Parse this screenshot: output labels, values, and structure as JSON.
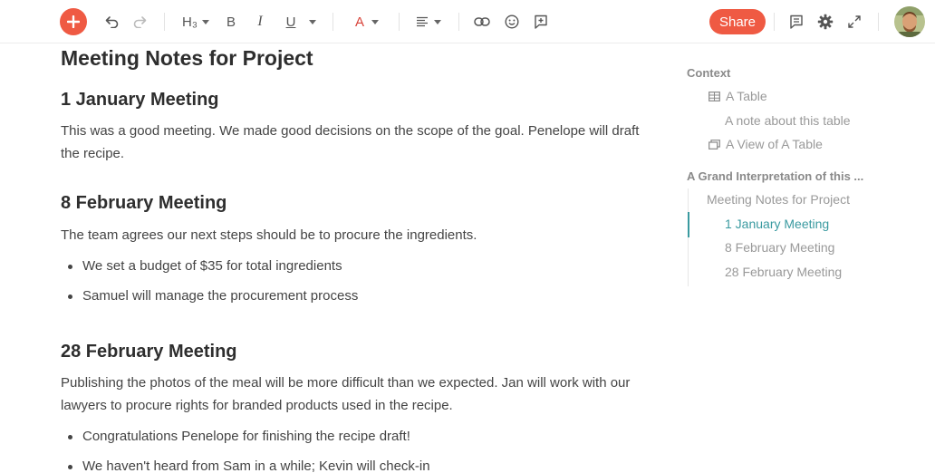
{
  "toolbar": {
    "heading_label": "H₃",
    "bold_label": "B",
    "italic_label": "I",
    "underline_label": "U",
    "color_label": "A",
    "share_label": "Share",
    "accent_color": "#ef5a43"
  },
  "document": {
    "title": "Meeting Notes for Project",
    "sections": [
      {
        "heading": "1 January Meeting",
        "paragraph": "This was a good meeting. We made good decisions on the scope of the goal. Penelope will draft the recipe."
      },
      {
        "heading": "8 February Meeting",
        "paragraph": "The team agrees our next steps should be to procure the ingredients.",
        "bullets": [
          "We set a budget of $35 for total ingredients",
          "Samuel will manage the procurement process"
        ]
      },
      {
        "heading": "28 February Meeting",
        "paragraph": "Publishing the photos of the meal will be more difficult than we expected. Jan will work with our lawyers to procure rights for branded products used in the recipe.",
        "bullets": [
          "Congratulations Penelope for finishing the recipe draft!",
          "We haven't heard from Sam in a while; Kevin will check-in"
        ]
      }
    ]
  },
  "outline": {
    "context_label": "Context",
    "context_items": [
      "A Table",
      "A note about this table",
      "A View of A Table"
    ],
    "section_label": "A Grand Interpretation of this ...",
    "section_items": [
      "Meeting Notes for Project",
      "1 January Meeting",
      "8 February Meeting",
      "28 February Meeting"
    ],
    "active_item": "1 January Meeting",
    "active_color": "#3a9aa0"
  }
}
